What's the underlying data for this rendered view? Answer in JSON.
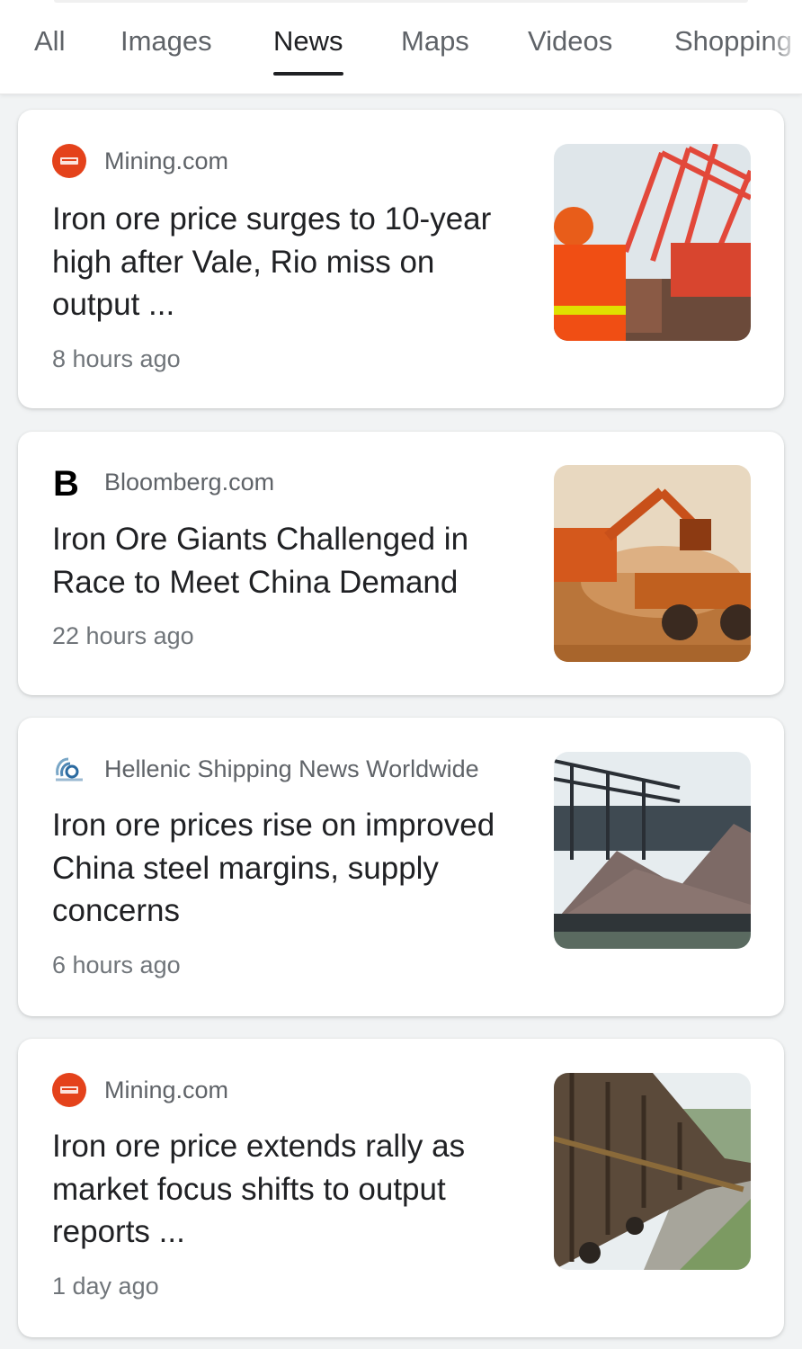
{
  "tabs": [
    {
      "label": "All",
      "active": false
    },
    {
      "label": "Images",
      "active": false
    },
    {
      "label": "News",
      "active": true
    },
    {
      "label": "Maps",
      "active": false
    },
    {
      "label": "Videos",
      "active": false
    },
    {
      "label": "Shopping",
      "active": false
    }
  ],
  "articles": [
    {
      "source": "Mining.com",
      "source_icon": "mining-com-favicon",
      "headline": "Iron ore price surges to 10-year high after Vale, Rio miss on output ...",
      "time": "8 hours ago",
      "thumbnail": "port-cranes-worker-photo"
    },
    {
      "source": "Bloomberg.com",
      "source_icon": "bloomberg-favicon",
      "headline": "Iron Ore Giants Challenged in Race to Meet China Demand",
      "time": "22 hours ago",
      "thumbnail": "excavator-loading-truck-photo"
    },
    {
      "source": "Hellenic Shipping News Worldwide",
      "source_icon": "hellenic-shipping-favicon",
      "headline": "Iron ore prices rise on improved China steel margins, supply concerns",
      "time": "6 hours ago",
      "thumbnail": "ore-stockpile-photo"
    },
    {
      "source": "Mining.com",
      "source_icon": "mining-com-favicon",
      "headline": "Iron ore price extends rally as market focus shifts to output reports ...",
      "time": "1 day ago",
      "thumbnail": "ore-train-wagons-photo"
    }
  ],
  "colors": {
    "mining_favicon": "#e4421b",
    "active_tab_underline": "#202124"
  }
}
